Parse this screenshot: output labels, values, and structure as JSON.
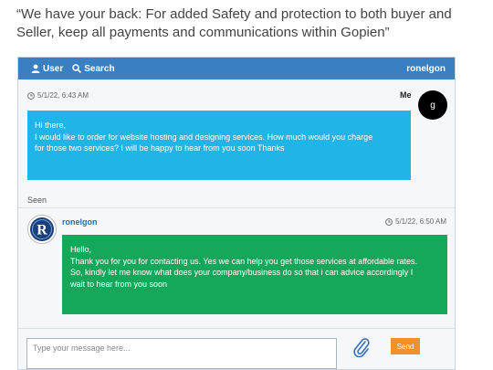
{
  "notice": "“We have your back: For added Safety and protection to both buyer and Seller, keep all payments and communications within Gopien”",
  "header": {
    "user_label": "User",
    "search_label": "Search",
    "username": "ronelgon"
  },
  "messages": {
    "outgoing": {
      "timestamp": "5/1/22, 6:43 AM",
      "sender": "Me",
      "avatar_letter": "g",
      "lines": [
        "Hi there,",
        "I would like to order for website hosting and designing services. How much would you charge",
        "for those two services? I will be happy to hear from you soon Thanks"
      ]
    },
    "seen": "Seen",
    "incoming": {
      "sender": "ronelgon",
      "timestamp": "5/1/22, 6:50 AM",
      "avatar_letter": "R",
      "lines": [
        "Hello,",
        "Thank you for you for contacting us. Yes we can help you get those services at affordable rates.",
        "So, kindly let me know what does your company/business do so that i can advice accordingly I",
        "wait to hear from you soon"
      ]
    }
  },
  "composer": {
    "placeholder": "Type your message here...",
    "send_label": "Send"
  },
  "colors": {
    "header": "#3a7fc1",
    "outgoing_bubble": "#1fb5e6",
    "incoming_bubble": "#16a85a",
    "send_button": "#f0922b"
  },
  "icons": {
    "user": "user-icon",
    "search": "search-icon",
    "clock": "clock-icon",
    "attach": "paperclip-icon"
  }
}
